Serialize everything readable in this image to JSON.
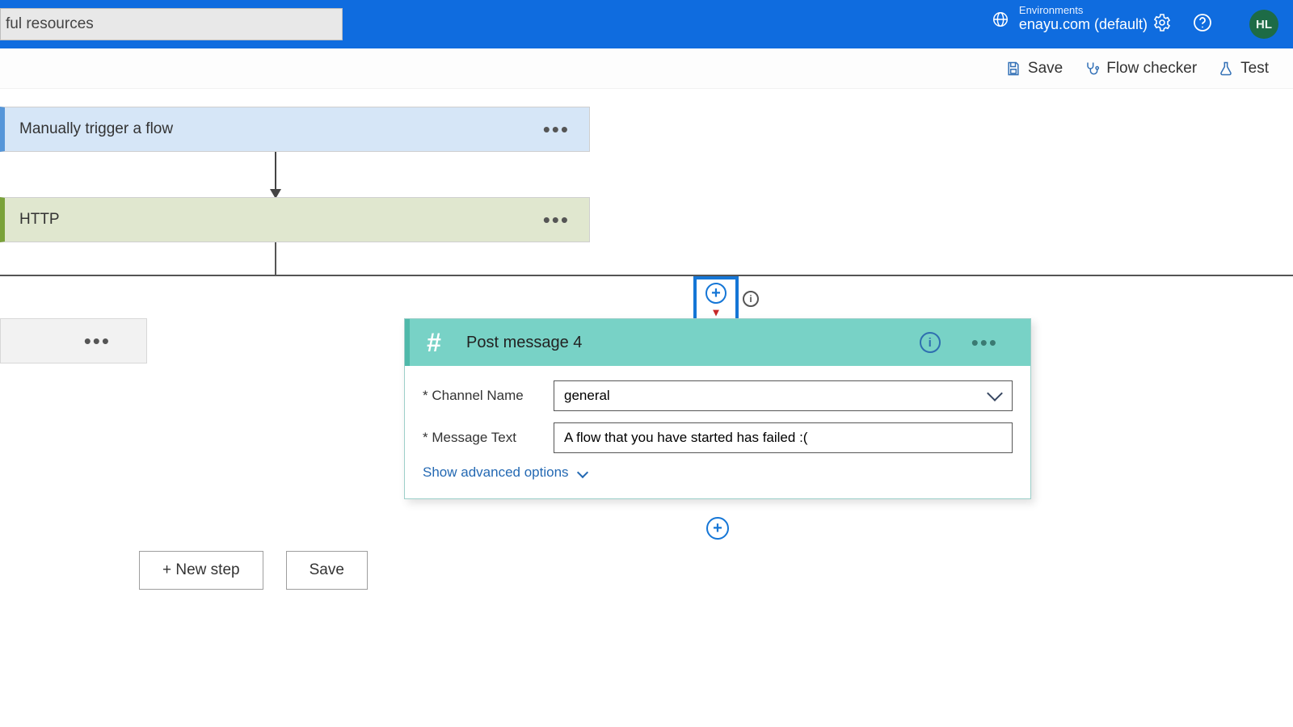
{
  "topbar": {
    "search_value": "ful resources",
    "env_label": "Environments",
    "env_name": "enayu.com (default)",
    "avatar_initials": "HL"
  },
  "cmdbar": {
    "save": "Save",
    "flowchecker": "Flow checker",
    "test": "Test"
  },
  "steps": {
    "trigger_title": "Manually trigger a flow",
    "http_title": "HTTP"
  },
  "slack": {
    "title": "Post message 4",
    "channel_label": "Channel Name",
    "channel_value": "general",
    "message_label": "Message Text",
    "message_value": "A flow that you have started has failed :(",
    "advanced": "Show advanced options"
  },
  "bottom": {
    "newstep": "+ New step",
    "save": "Save"
  }
}
